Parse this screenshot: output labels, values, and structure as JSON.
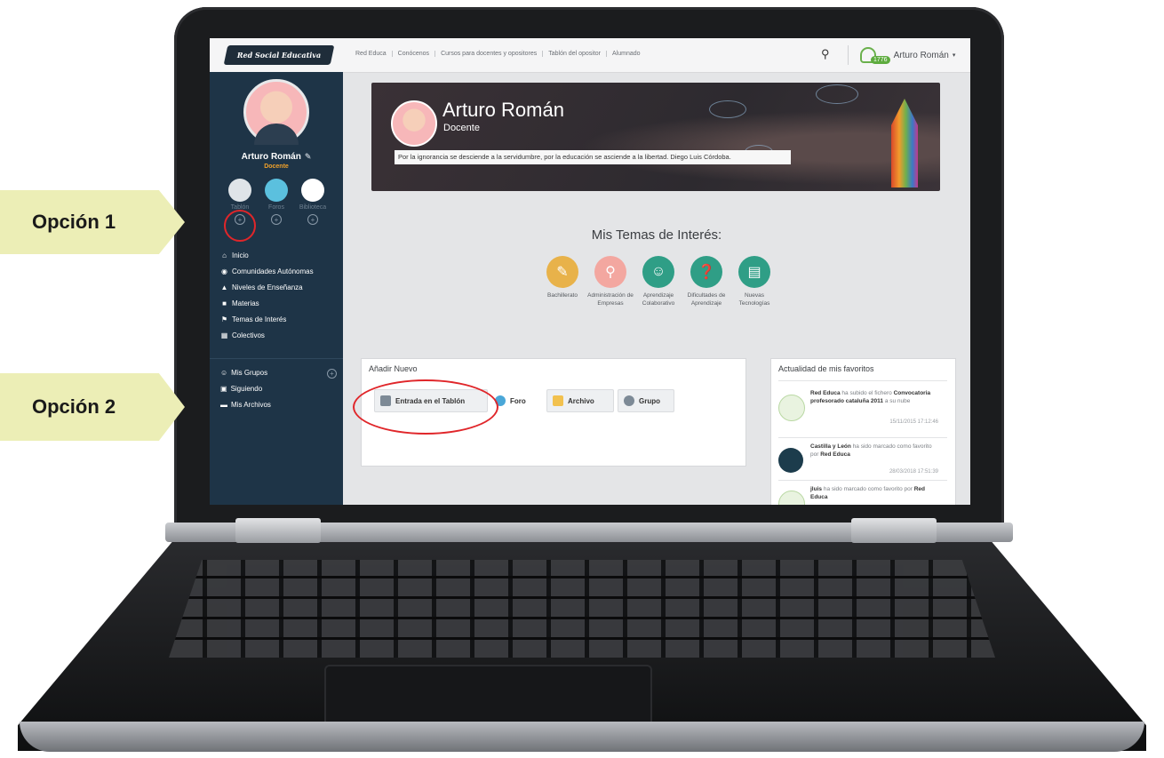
{
  "callouts": {
    "option1": "Opción 1",
    "option2": "Opción 2"
  },
  "topbar": {
    "logo_text": "Red Social Educativa",
    "nav": [
      "Red Educa",
      "Conócenos",
      "Cursos para docentes y opositores",
      "Tablón del opositor",
      "Alumnado"
    ],
    "search_icon": "search-icon",
    "notification_count": "1776",
    "user_name": "Arturo Román",
    "user_caret": "▾"
  },
  "sidebar": {
    "name": "Arturo Román",
    "role": "Docente",
    "quick": [
      {
        "label": "Tablón",
        "add": "+"
      },
      {
        "label": "Foros",
        "add": "+"
      },
      {
        "label": "Biblioteca",
        "add": "+"
      }
    ],
    "menu": [
      {
        "icon": "home-icon",
        "label": "Inicio"
      },
      {
        "icon": "map-pin-icon",
        "label": "Comunidades Autónomas"
      },
      {
        "icon": "graduation-icon",
        "label": "Niveles de Enseñanza"
      },
      {
        "icon": "folder-icon",
        "label": "Materias"
      },
      {
        "icon": "flag-icon",
        "label": "Temas de Interés"
      },
      {
        "icon": "grid-icon",
        "label": "Colectivos"
      }
    ],
    "menu2": [
      {
        "icon": "group-icon",
        "label": "Mis Grupos"
      },
      {
        "icon": "follow-icon",
        "label": "Siguiendo"
      },
      {
        "icon": "folder-icon",
        "label": "Mis Archivos"
      }
    ]
  },
  "banner": {
    "name": "Arturo Román",
    "role": "Docente",
    "quote": "Por la ignorancia se desciende a la servidumbre, por la educación se asciende a la libertad. Diego Luis Córdoba."
  },
  "interests": {
    "title": "Mis Temas de Interés:",
    "topics": [
      {
        "label": "Bachillerato",
        "color": "#e8b24a",
        "icon": "pen-icon"
      },
      {
        "label": "Administración de Empresas",
        "color": "#f3a7a0",
        "icon": "key-icon"
      },
      {
        "label": "Aprendizaje Colaborativo",
        "color": "#2f9e86",
        "icon": "people-icon"
      },
      {
        "label": "Dificultades de Aprendizaje",
        "color": "#2f9e86",
        "icon": "brain-icon"
      },
      {
        "label": "Nuevas Tecnologías",
        "color": "#2f9e86",
        "icon": "monitor-icon"
      }
    ]
  },
  "add_new": {
    "title": "Añadir Nuevo",
    "buttons": [
      {
        "label": "Entrada en el Tablón",
        "icon": "board-icon",
        "color": "#7d8a96"
      },
      {
        "label": "Foro",
        "icon": "chat-icon",
        "color": "#4aa7d8"
      },
      {
        "label": "Archivo",
        "icon": "folder-icon",
        "color": "#f2c14e"
      },
      {
        "label": "Grupo",
        "icon": "group-icon",
        "color": "#7d8a96"
      }
    ]
  },
  "favorites": {
    "title": "Actualidad de mis favoritos",
    "items": [
      {
        "actor": "Red Educa",
        "text1": "ha subido el fichero",
        "object": "Convocatoria profesorado cataluña 2011",
        "text2": "a su nube",
        "time": "15/11/2015 17:12:46"
      },
      {
        "actor": "Castilla y León",
        "text1": "ha sido marcado como favorito por",
        "object": "Red Educa",
        "text2": "",
        "time": "28/03/2018 17:51:39"
      },
      {
        "actor": "jluis",
        "text1": "ha sido marcado como favorito por",
        "object": "Red Educa",
        "text2": "",
        "time": ""
      }
    ]
  }
}
